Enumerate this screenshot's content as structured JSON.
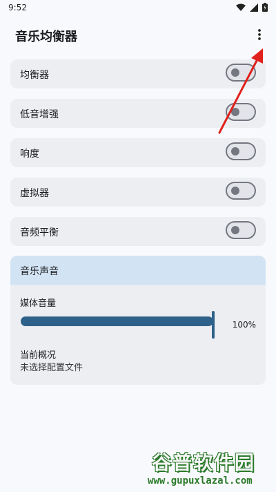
{
  "status_bar": {
    "time": "9:52"
  },
  "app_bar": {
    "title": "音乐均衡器"
  },
  "toggles": [
    {
      "label": "均衡器",
      "enabled": false
    },
    {
      "label": "低音增强",
      "enabled": false
    },
    {
      "label": "响度",
      "enabled": false
    },
    {
      "label": "虚拟器",
      "enabled": false
    },
    {
      "label": "音频平衡",
      "enabled": false
    }
  ],
  "music_sound": {
    "title": "音乐声音",
    "media_volume_label": "媒体音量",
    "media_volume_value": "100%",
    "media_volume_level": 1.0,
    "profile_label": "当前概况",
    "profile_value": "未选择配置文件"
  },
  "watermark": {
    "title": "谷普软件园",
    "url": "www.gupuxlazal.com"
  },
  "colors": {
    "accent": "#2e6189",
    "annotation_arrow": "#e0211c",
    "header_tint": "#d2e3f4"
  }
}
